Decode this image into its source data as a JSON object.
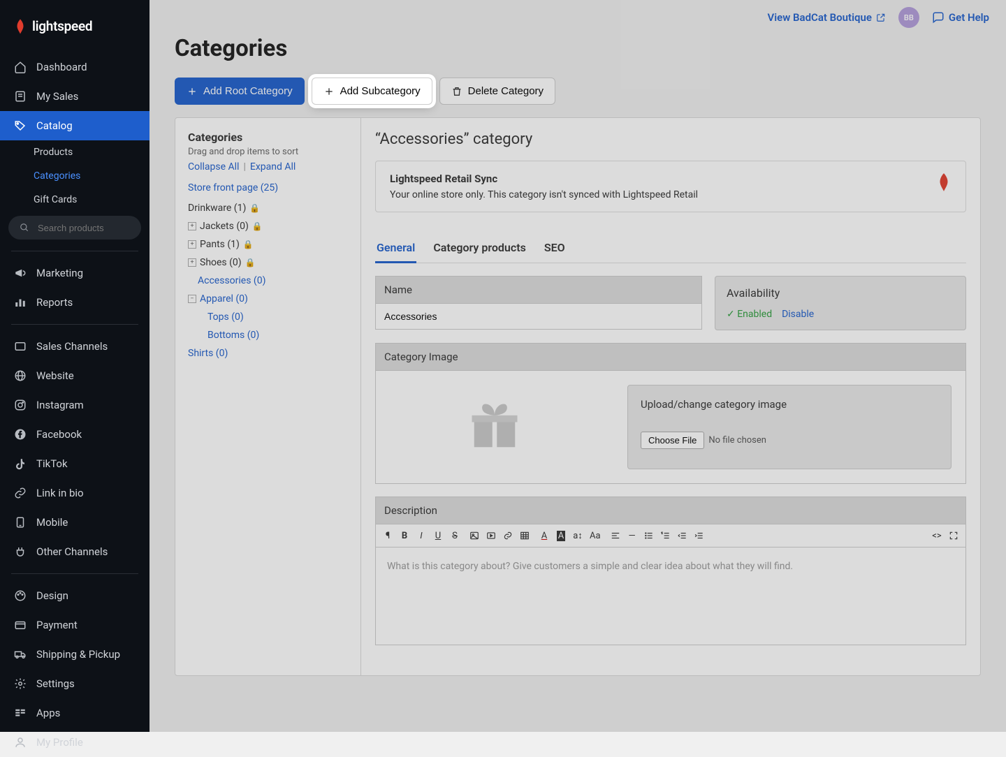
{
  "brand": {
    "name": "lightspeed"
  },
  "topbar": {
    "viewStore": "View BadCat Boutique",
    "avatar": "BB",
    "help": "Get Help"
  },
  "sidebar": {
    "items": [
      {
        "label": "Dashboard"
      },
      {
        "label": "My Sales"
      },
      {
        "label": "Catalog",
        "active": true,
        "sub": [
          {
            "label": "Products"
          },
          {
            "label": "Categories",
            "active": true
          },
          {
            "label": "Gift Cards"
          }
        ]
      },
      {
        "label": "Marketing"
      },
      {
        "label": "Reports"
      },
      {
        "label": "Sales Channels"
      },
      {
        "label": "Website"
      },
      {
        "label": "Instagram"
      },
      {
        "label": "Facebook"
      },
      {
        "label": "TikTok"
      },
      {
        "label": "Link in bio"
      },
      {
        "label": "Mobile"
      },
      {
        "label": "Other Channels"
      },
      {
        "label": "Design"
      },
      {
        "label": "Payment"
      },
      {
        "label": "Shipping & Pickup"
      },
      {
        "label": "Settings"
      },
      {
        "label": "Apps"
      },
      {
        "label": "My Profile"
      }
    ],
    "searchPlaceholder": "Search products"
  },
  "page": {
    "title": "Categories",
    "buttons": {
      "addRoot": "Add Root Category",
      "addSub": "Add Subcategory",
      "delete": "Delete Category"
    },
    "tree": {
      "title": "Categories",
      "hint": "Drag and drop items to sort",
      "collapse": "Collapse All",
      "expand": "Expand All",
      "root": "Store front page (25)",
      "items": [
        {
          "label": "Drinkware (1)",
          "lock": true
        },
        {
          "label": "Jackets (0)",
          "lock": true,
          "exp": "+"
        },
        {
          "label": "Pants (1)",
          "lock": true,
          "exp": "+"
        },
        {
          "label": "Shoes (0)",
          "lock": true,
          "exp": "+"
        },
        {
          "label": "Accessories (0)",
          "link": true,
          "indent": 1
        },
        {
          "label": "Apparel (0)",
          "link": true,
          "exp": "-"
        },
        {
          "label": "Tops (0)",
          "link": true,
          "indent": 2
        },
        {
          "label": "Bottoms (0)",
          "link": true,
          "indent": 2
        },
        {
          "label": "Shirts (0)",
          "link": true
        }
      ]
    },
    "detail": {
      "title": "“Accessories” category",
      "sync": {
        "title": "Lightspeed Retail Sync",
        "body": "Your online store only. This category isn't synced with Lightspeed Retail"
      },
      "tabs": {
        "general": "General",
        "products": "Category products",
        "seo": "SEO"
      },
      "nameLabel": "Name",
      "nameValue": "Accessories",
      "availability": {
        "title": "Availability",
        "enabled": "Enabled",
        "disable": "Disable"
      },
      "imageLabel": "Category Image",
      "uploadText": "Upload/change category image",
      "chooseFile": "Choose File",
      "noFile": "No file chosen",
      "descLabel": "Description",
      "descPlaceholder": "What is this category about? Give customers a simple and clear idea about what they will find."
    }
  }
}
